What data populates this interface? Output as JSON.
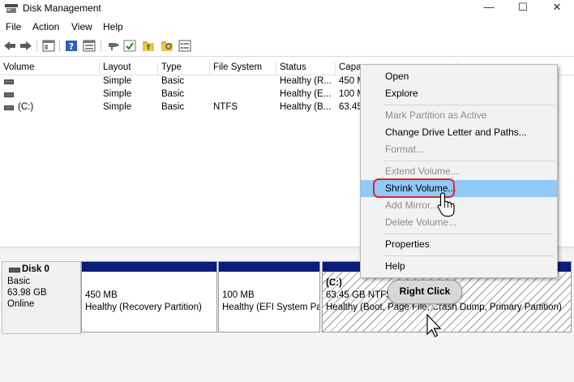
{
  "window": {
    "title": "Disk Management",
    "controls": {
      "minimize": "—",
      "maximize": "☐",
      "close": "✕"
    }
  },
  "menubar": [
    "File",
    "Action",
    "View",
    "Help"
  ],
  "toolbar_icons": [
    "back-arrow-icon",
    "forward-arrow-icon",
    "properties-icon",
    "help-icon",
    "show-pane-icon",
    "connect-icon",
    "check-icon",
    "folder-up-icon",
    "open-folder-icon",
    "list-view-icon"
  ],
  "volume_table": {
    "columns": [
      "Volume",
      "Layout",
      "Type",
      "File System",
      "Status",
      "Capa",
      "",
      ""
    ],
    "rows": [
      {
        "volume": "",
        "layout": "Simple",
        "type": "Basic",
        "fs": "",
        "status": "Healthy (R...",
        "capacity": "450 M"
      },
      {
        "volume": "",
        "layout": "Simple",
        "type": "Basic",
        "fs": "",
        "status": "Healthy (E...",
        "capacity": "100 M"
      },
      {
        "volume": "(C:)",
        "layout": "Simple",
        "type": "Basic",
        "fs": "NTFS",
        "status": "Healthy (B...",
        "capacity": "63.45"
      }
    ]
  },
  "disk": {
    "name": "Disk 0",
    "type": "Basic",
    "size": "63.98 GB",
    "state": "Online",
    "partitions": [
      {
        "size": "450 MB",
        "status": "Healthy (Recovery Partition)",
        "label": ""
      },
      {
        "size": "100 MB",
        "status": "Healthy (EFI System Pa",
        "label": ""
      },
      {
        "label": "(C:)",
        "size": "63.45 GB NTFS",
        "status": "Healthy (Boot, Page File, Crash Dump, Primary Partition)"
      }
    ]
  },
  "context_menu": {
    "open": "Open",
    "explore": "Explore",
    "mark_active": "Mark Partition as Active",
    "change_letter": "Change Drive Letter and Paths...",
    "format": "Format...",
    "extend": "Extend Volume...",
    "shrink": "Shrink Volume...",
    "add_mirror": "Add Mirror...",
    "delete": "Delete Volume...",
    "properties": "Properties",
    "help": "Help"
  },
  "callout": {
    "text": "Right Click"
  },
  "colors": {
    "partition_bar": "#0a1c7c",
    "menu_highlight": "#91c9f7",
    "ring": "#e0232e"
  }
}
